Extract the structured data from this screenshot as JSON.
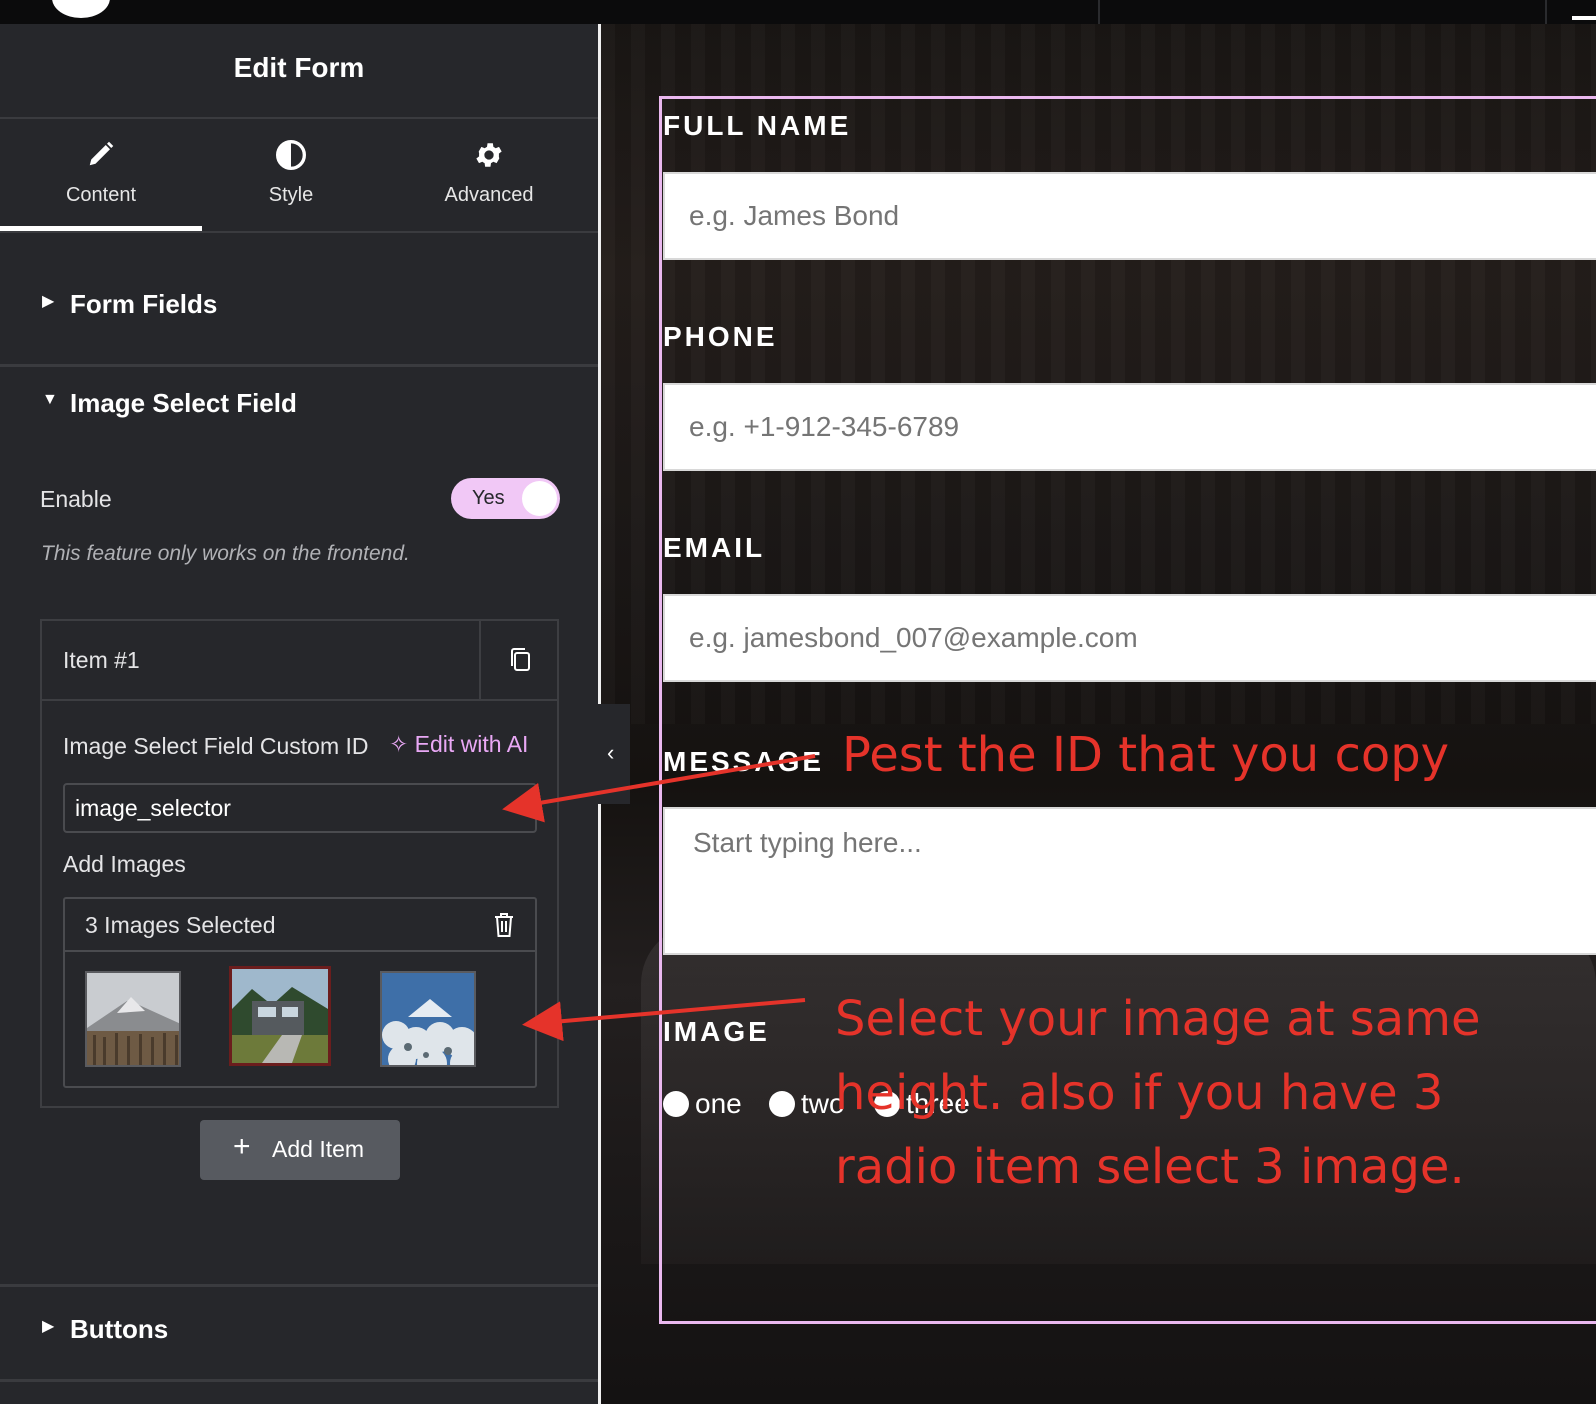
{
  "panel": {
    "title": "Edit Form",
    "tabs": [
      {
        "label": "Content",
        "icon": "pencil-icon",
        "active": true
      },
      {
        "label": "Style",
        "icon": "contrast-icon",
        "active": false
      },
      {
        "label": "Advanced",
        "icon": "gear-icon",
        "active": false
      }
    ],
    "sections": {
      "form_fields": "Form Fields",
      "image_select": "Image Select Field",
      "buttons": "Buttons"
    },
    "enable": {
      "label": "Enable",
      "toggle_label": "Yes",
      "value": true
    },
    "note": "This feature only works on the frontend.",
    "item": {
      "title": "Item #1",
      "custom_id_label": "Image Select Field Custom ID",
      "ai_label": "Edit with AI",
      "custom_id_value": "image_selector",
      "add_images_label": "Add Images",
      "gallery_label": "3 Images Selected",
      "images_count": 3
    },
    "add_item_label": "Add Item"
  },
  "form": {
    "fields": [
      {
        "label": "FULL NAME",
        "placeholder": "e.g. James Bond"
      },
      {
        "label": "PHONE",
        "placeholder": "e.g. +1-912-345-6789"
      },
      {
        "label": "EMAIL",
        "placeholder": "e.g. jamesbond_007@example.com"
      },
      {
        "label": "MESSAGE",
        "placeholder": "Start typing here..."
      }
    ],
    "image_label": "IMAGE",
    "radios": [
      "one",
      "two",
      "three"
    ]
  },
  "annotations": {
    "paste_id": "Pest the ID that you copy",
    "select_image": [
      "Select your image at same",
      "height. also if you have 3",
      "radio item select 3 image."
    ]
  },
  "colors": {
    "accent": "#e9a8f5",
    "annotation": "#e5332a",
    "outline": "#eab8ef"
  }
}
